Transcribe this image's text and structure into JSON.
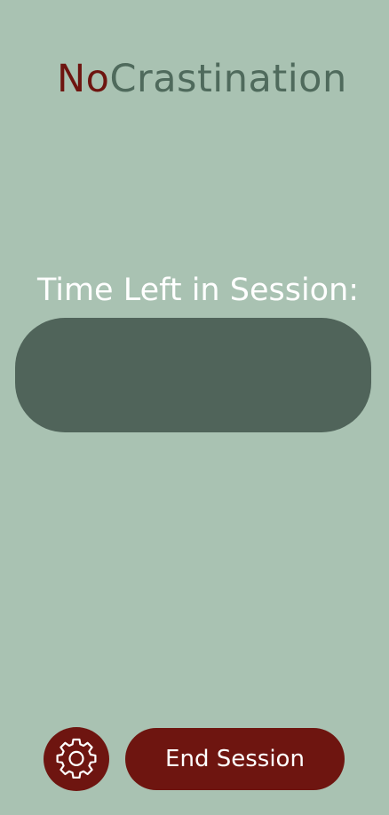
{
  "app": {
    "title_part1": "No",
    "title_part2": "Crastination"
  },
  "timer": {
    "label": "Time Left in Session:",
    "value": ""
  },
  "actions": {
    "settings_icon": "gear-icon",
    "end_session_label": "End Session"
  },
  "colors": {
    "background": "#a9c2b2",
    "accent": "#6e1510",
    "dark_green": "#50645a",
    "title_green": "#4f6a5c"
  }
}
